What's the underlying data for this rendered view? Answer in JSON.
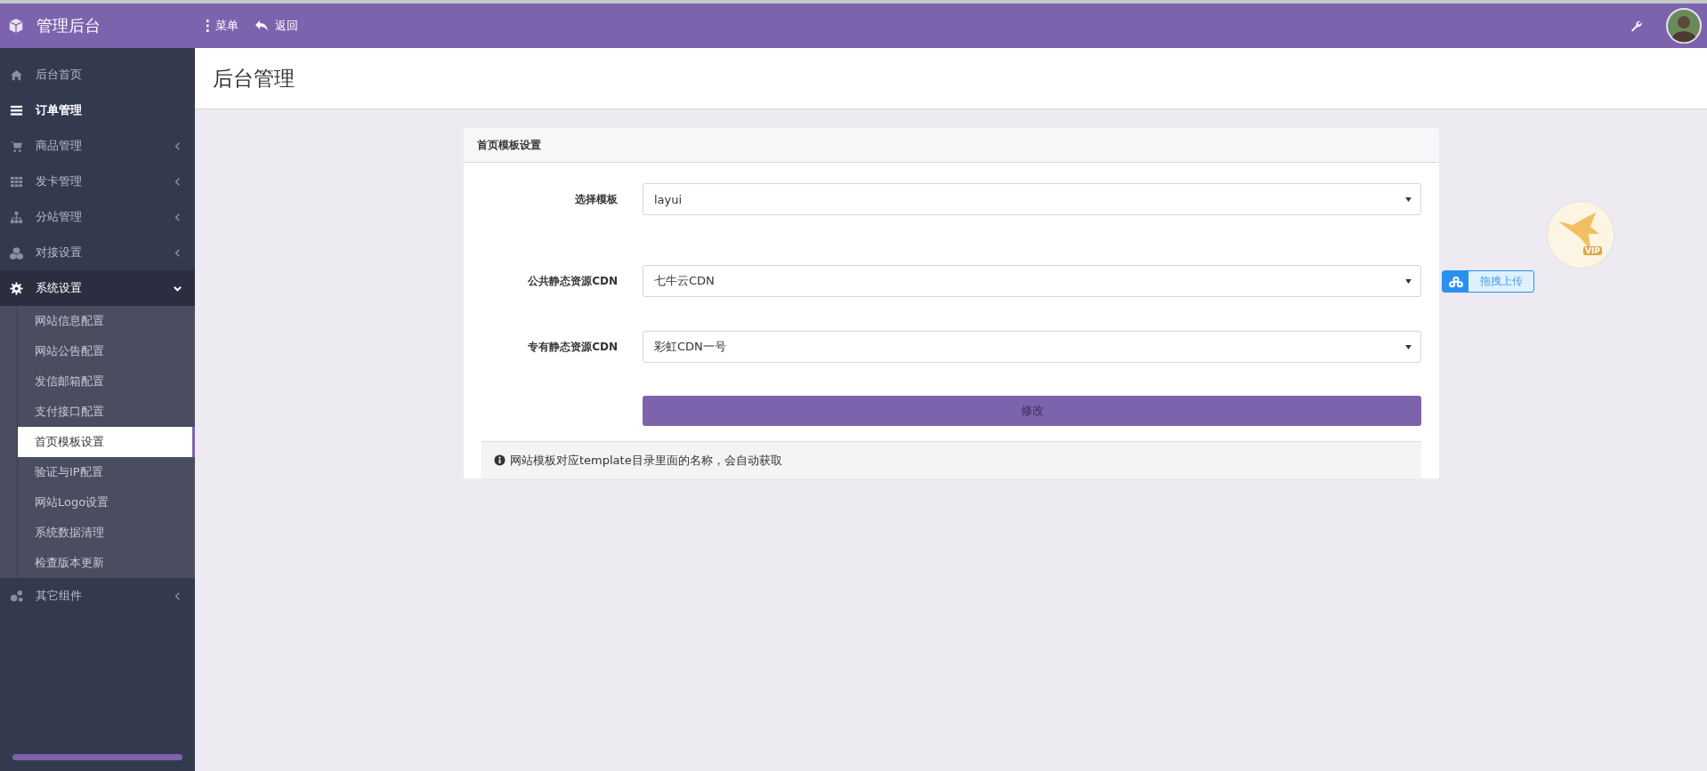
{
  "topbar": {
    "title": "管理后台",
    "actions": [
      {
        "label": "菜单",
        "kind": "menu"
      },
      {
        "label": "返回",
        "kind": "back"
      }
    ]
  },
  "sidebar": {
    "items": [
      {
        "label": "后台首页",
        "kind": "link",
        "highlighted": false
      },
      {
        "label": "订单管理",
        "kind": "link",
        "highlighted": true
      },
      {
        "label": "商品管理",
        "kind": "menu",
        "highlighted": false,
        "expanded": false
      },
      {
        "label": "发卡管理",
        "kind": "menu",
        "highlighted": false,
        "expanded": false
      },
      {
        "label": "分站管理",
        "kind": "menu",
        "highlighted": false,
        "expanded": false
      },
      {
        "label": "对接设置",
        "kind": "menu",
        "highlighted": false,
        "expanded": false
      },
      {
        "label": "系统设置",
        "kind": "menu",
        "highlighted": false,
        "expanded": true,
        "children": [
          {
            "label": "网站信息配置",
            "selected": false
          },
          {
            "label": "网站公告配置",
            "selected": false
          },
          {
            "label": "发信邮箱配置",
            "selected": false
          },
          {
            "label": "支付接口配置",
            "selected": false
          },
          {
            "label": "首页模板设置",
            "selected": true
          },
          {
            "label": "验证与IP配置",
            "selected": false
          },
          {
            "label": "网站Logo设置",
            "selected": false
          },
          {
            "label": "系统数据清理",
            "selected": false
          },
          {
            "label": "检查版本更新",
            "selected": false
          }
        ]
      },
      {
        "label": "其它组件",
        "kind": "menu",
        "highlighted": false,
        "expanded": false
      }
    ]
  },
  "page_title": "后台管理",
  "panel": {
    "title": "首页模板设置",
    "fields": [
      {
        "label": "选择模板",
        "value": "layui"
      },
      {
        "label": "公共静态资源CDN",
        "value": "七牛云CDN"
      },
      {
        "label": "专有静态资源CDN",
        "value": "彩虹CDN一号"
      }
    ],
    "submit": "修改",
    "note": "网站模板对应template目录里面的名称，会自动获取"
  },
  "floating": {
    "badge_text": "VIP",
    "upload_label": "拖拽上传"
  }
}
